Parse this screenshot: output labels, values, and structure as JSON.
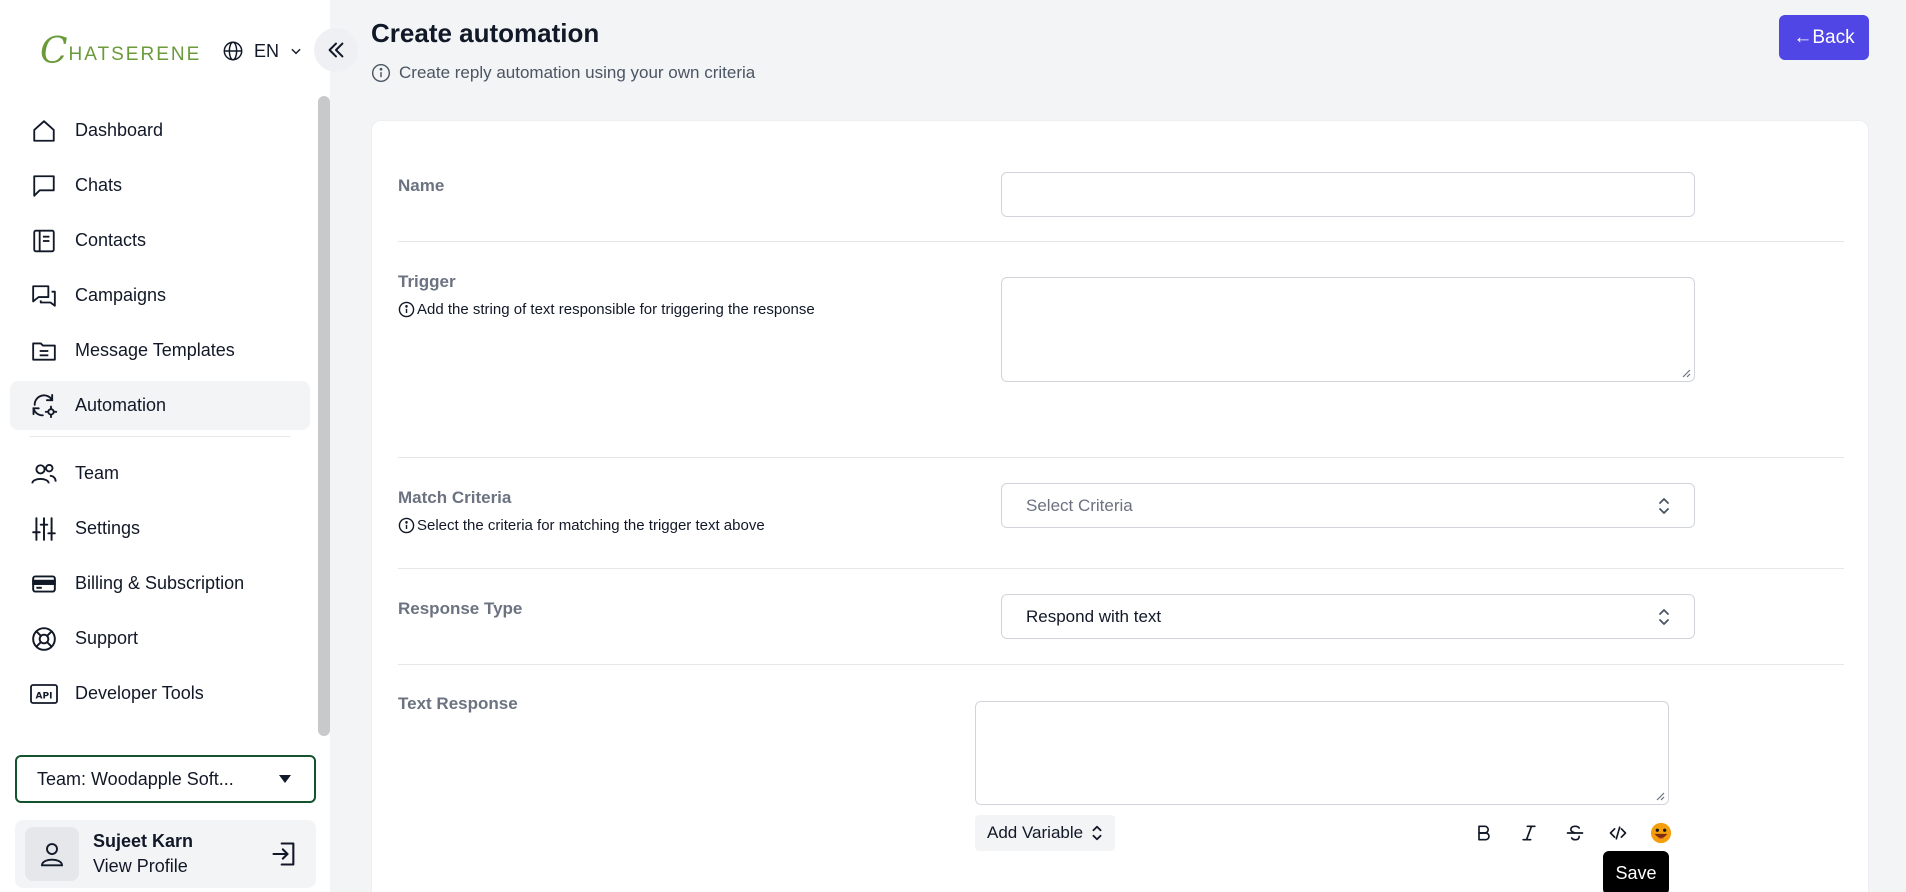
{
  "app": {
    "logo_initial": "C",
    "logo_text": "HATSERENE"
  },
  "language": {
    "code": "EN"
  },
  "sidebar": {
    "items": [
      {
        "label": "Dashboard",
        "icon": "home-icon"
      },
      {
        "label": "Chats",
        "icon": "chat-bubble-icon"
      },
      {
        "label": "Contacts",
        "icon": "contact-book-icon"
      },
      {
        "label": "Campaigns",
        "icon": "campaign-icon"
      },
      {
        "label": "Message Templates",
        "icon": "folder-icon"
      },
      {
        "label": "Automation",
        "icon": "automation-icon"
      },
      {
        "label": "Team",
        "icon": "team-icon"
      },
      {
        "label": "Settings",
        "icon": "sliders-icon"
      },
      {
        "label": "Billing & Subscription",
        "icon": "credit-card-icon"
      },
      {
        "label": "Support",
        "icon": "lifebuoy-icon"
      },
      {
        "label": "Developer Tools",
        "icon": "api-icon"
      }
    ],
    "active_index": 5,
    "team_select": "Team: Woodapple Soft...",
    "profile": {
      "name": "Sujeet Karn",
      "link": "View Profile"
    }
  },
  "header": {
    "title": "Create automation",
    "subtitle": "Create reply automation using your own criteria",
    "back_label": "←Back"
  },
  "form": {
    "name": {
      "label": "Name",
      "value": ""
    },
    "trigger": {
      "label": "Trigger",
      "help": "Add the string of text responsible for triggering the response",
      "value": ""
    },
    "match_criteria": {
      "label": "Match Criteria",
      "help": "Select the criteria for matching the trigger text above",
      "placeholder": "Select Criteria"
    },
    "response_type": {
      "label": "Response Type",
      "value": "Respond with text"
    },
    "text_response": {
      "label": "Text Response",
      "value": ""
    },
    "add_variable_label": "Add Variable",
    "save_label": "Save"
  },
  "colors": {
    "accent": "#4f46e5",
    "logo": "#6a9a3a",
    "team_border": "#14532d"
  }
}
